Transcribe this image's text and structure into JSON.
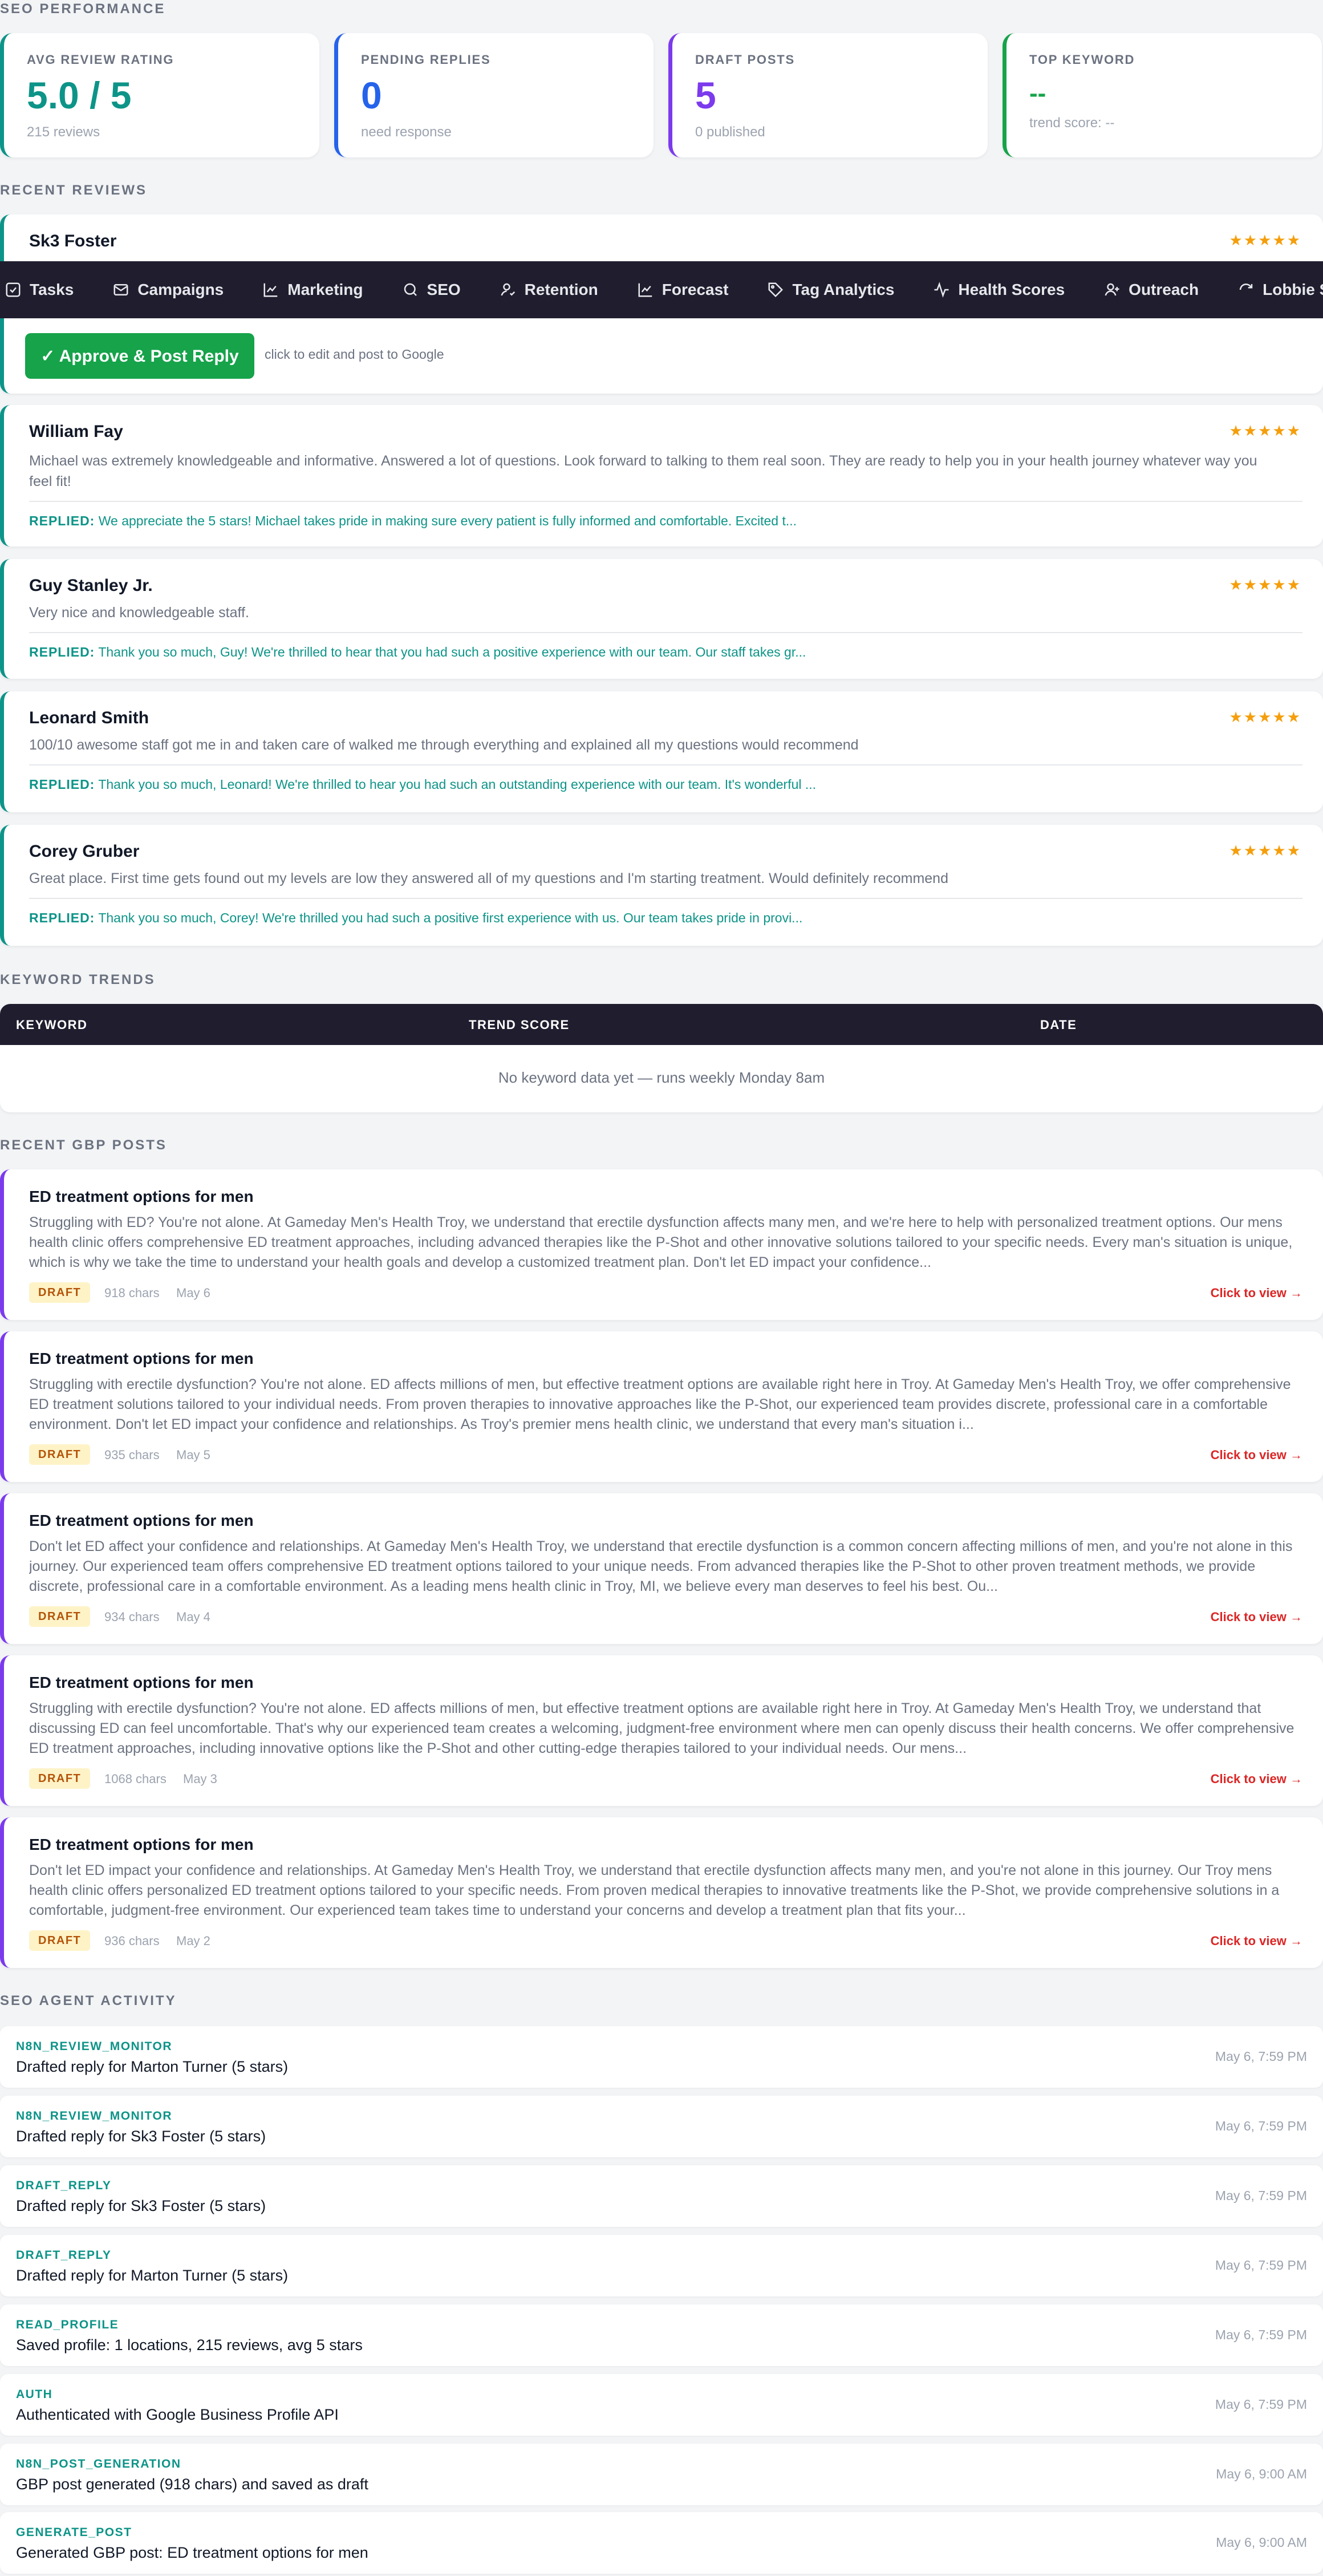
{
  "sections": {
    "seo_performance": "SEO PERFORMANCE",
    "recent_reviews": "RECENT REVIEWS",
    "keyword_trends": "KEYWORD TRENDS",
    "recent_gbp_posts": "RECENT GBP POSTS",
    "seo_agent_activity": "SEO AGENT ACTIVITY"
  },
  "stats": [
    {
      "label": "AVG REVIEW RATING",
      "value": "5.0 / 5",
      "sub": "215 reviews",
      "color": "#0d9488"
    },
    {
      "label": "PENDING REPLIES",
      "value": "0",
      "sub": "need response",
      "color": "#2563eb"
    },
    {
      "label": "DRAFT POSTS",
      "value": "5",
      "sub": "0 published",
      "color": "#7c3aed"
    },
    {
      "label": "TOP KEYWORD",
      "value": "--",
      "sub": "trend score: --",
      "color": "#16a34a"
    }
  ],
  "nav": {
    "items": [
      {
        "label": "Tasks",
        "icon": "checkbox-icon"
      },
      {
        "label": "Campaigns",
        "icon": "mail-icon"
      },
      {
        "label": "Marketing",
        "icon": "chart-line-icon"
      },
      {
        "label": "SEO",
        "icon": "search-icon"
      },
      {
        "label": "Retention",
        "icon": "user-retention-icon"
      },
      {
        "label": "Forecast",
        "icon": "chart-line-icon"
      },
      {
        "label": "Tag Analytics",
        "icon": "tag-icon"
      },
      {
        "label": "Health Scores",
        "icon": "pulse-icon"
      },
      {
        "label": "Outreach",
        "icon": "user-plus-icon"
      },
      {
        "label": "Lobbie Sync",
        "icon": "refresh-icon"
      }
    ]
  },
  "reviews": {
    "stars": "★★★★★",
    "reply_prefix": "REPLIED:",
    "pending": {
      "name": "Sk3 Foster",
      "approve_label": "✓ Approve & Post Reply",
      "approve_hint": "click to edit and post to Google"
    },
    "items": [
      {
        "name": "William Fay",
        "text": "Michael was extremely knowledgeable and informative. Answered a lot of questions. Look forward to talking to them real soon. They are ready to help you in your health journey whatever way you feel fit!",
        "reply": "We appreciate the 5 stars! Michael takes pride in making sure every patient is fully informed and comfortable. Excited t..."
      },
      {
        "name": "Guy Stanley Jr.",
        "text": "Very nice and knowledgeable staff.",
        "reply": "Thank you so much, Guy! We're thrilled to hear that you had such a positive experience with our team. Our staff takes gr..."
      },
      {
        "name": "Leonard Smith",
        "text": "100/10 awesome staff got me in and taken care of walked me through everything and explained all my questions would recommend",
        "reply": "Thank you so much, Leonard! We're thrilled to hear you had such an outstanding experience with our team. It's wonderful ..."
      },
      {
        "name": "Corey Gruber",
        "text": "Great place. First time gets found out my levels are low they answered all of my questions and I'm starting treatment. Would definitely recommend",
        "reply": "Thank you so much, Corey! We're thrilled you had such a positive first experience with us. Our team takes pride in provi..."
      }
    ]
  },
  "keywords": {
    "headers": [
      "KEYWORD",
      "TREND SCORE",
      "DATE"
    ],
    "empty_text": "No keyword data yet — runs weekly Monday 8am"
  },
  "posts": {
    "badge": "DRAFT",
    "view_label": "Click to view →",
    "items": [
      {
        "title": "ED treatment options for men",
        "body": "Struggling with ED? You're not alone. At Gameday Men's Health Troy, we understand that erectile dysfunction affects many men, and we're here to help with personalized treatment options. Our mens health clinic offers comprehensive ED treatment approaches, including advanced therapies like the P-Shot and other innovative solutions tailored to your specific needs. Every man's situation is unique, which is why we take the time to understand your health goals and develop a customized treatment plan. Don't let ED impact your confidence...",
        "chars": "918 chars",
        "date": "May 6"
      },
      {
        "title": "ED treatment options for men",
        "body": "Struggling with erectile dysfunction? You're not alone. ED affects millions of men, but effective treatment options are available right here in Troy. At Gameday Men's Health Troy, we offer comprehensive ED treatment solutions tailored to your individual needs. From proven therapies to innovative approaches like the P-Shot, our experienced team provides discrete, professional care in a comfortable environment. Don't let ED impact your confidence and relationships. As Troy's premier mens health clinic, we understand that every man's situation i...",
        "chars": "935 chars",
        "date": "May 5"
      },
      {
        "title": "ED treatment options for men",
        "body": "Don't let ED affect your confidence and relationships. At Gameday Men's Health Troy, we understand that erectile dysfunction is a common concern affecting millions of men, and you're not alone in this journey. Our experienced team offers comprehensive ED treatment options tailored to your unique needs. From advanced therapies like the P-Shot to other proven treatment methods, we provide discrete, professional care in a comfortable environment. As a leading mens health clinic in Troy, MI, we believe every man deserves to feel his best. Ou...",
        "chars": "934 chars",
        "date": "May 4"
      },
      {
        "title": "ED treatment options for men",
        "body": "Struggling with erectile dysfunction? You're not alone. ED affects millions of men, but effective treatment options are available right here in Troy. At Gameday Men's Health Troy, we understand that discussing ED can feel uncomfortable. That's why our experienced team creates a welcoming, judgment-free environment where men can openly discuss their health concerns. We offer comprehensive ED treatment approaches, including innovative options like the P-Shot and other cutting-edge therapies tailored to your individual needs. Our mens...",
        "chars": "1068 chars",
        "date": "May 3"
      },
      {
        "title": "ED treatment options for men",
        "body": "Don't let ED impact your confidence and relationships. At Gameday Men's Health Troy, we understand that erectile dysfunction affects many men, and you're not alone in this journey. Our Troy mens health clinic offers personalized ED treatment options tailored to your specific needs. From proven medical therapies to innovative treatments like the P-Shot, we provide comprehensive solutions in a comfortable, judgment-free environment. Our experienced team takes time to understand your concerns and develop a treatment plan that fits your...",
        "chars": "936 chars",
        "date": "May 2"
      }
    ]
  },
  "activity": [
    {
      "agent": "N8N_REVIEW_MONITOR",
      "desc": "Drafted reply for Marton Turner (5 stars)",
      "time": "May 6, 7:59 PM"
    },
    {
      "agent": "N8N_REVIEW_MONITOR",
      "desc": "Drafted reply for Sk3 Foster (5 stars)",
      "time": "May 6, 7:59 PM"
    },
    {
      "agent": "DRAFT_REPLY",
      "desc": "Drafted reply for Sk3 Foster (5 stars)",
      "time": "May 6, 7:59 PM"
    },
    {
      "agent": "DRAFT_REPLY",
      "desc": "Drafted reply for Marton Turner (5 stars)",
      "time": "May 6, 7:59 PM"
    },
    {
      "agent": "READ_PROFILE",
      "desc": "Saved profile: 1 locations, 215 reviews, avg 5 stars",
      "time": "May 6, 7:59 PM"
    },
    {
      "agent": "AUTH",
      "desc": "Authenticated with Google Business Profile API",
      "time": "May 6, 7:59 PM"
    },
    {
      "agent": "N8N_POST_GENERATION",
      "desc": "GBP post generated (918 chars) and saved as draft",
      "time": "May 6, 9:00 AM"
    },
    {
      "agent": "GENERATE_POST",
      "desc": "Generated GBP post: ED treatment options for men",
      "time": "May 6, 9:00 AM"
    }
  ]
}
